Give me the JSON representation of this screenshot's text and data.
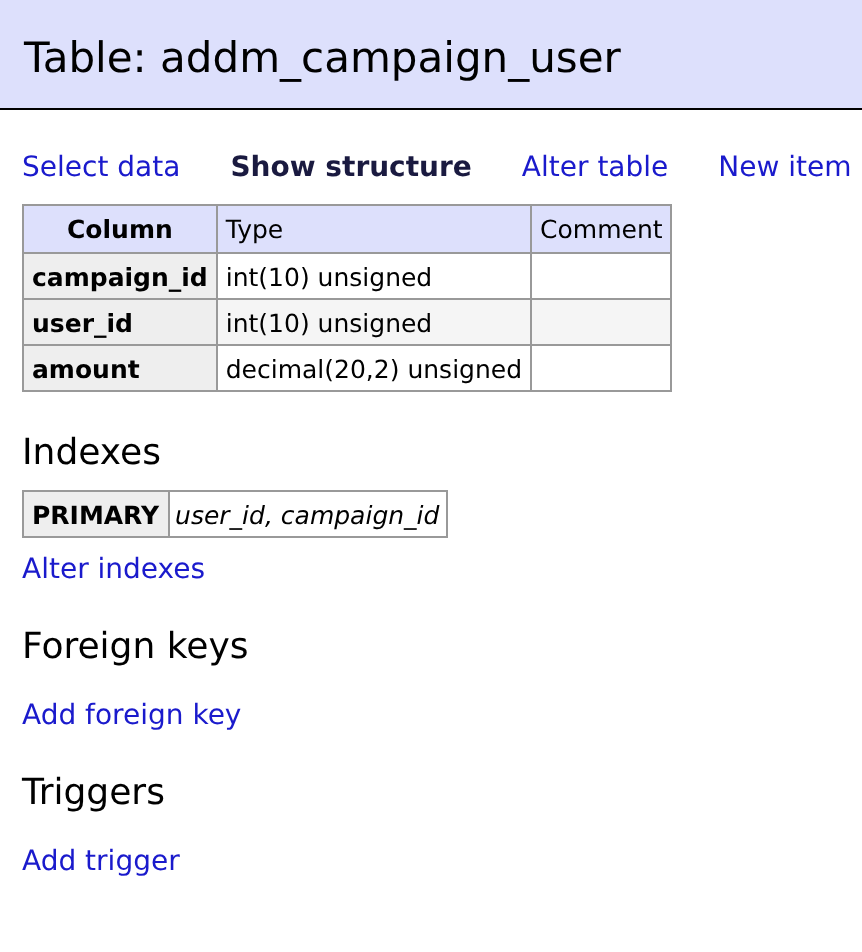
{
  "title": "Table: addm_campaign_user",
  "menu": [
    {
      "label": "Select data",
      "selected": false
    },
    {
      "label": "Show structure",
      "selected": true
    },
    {
      "label": "Alter table",
      "selected": false
    },
    {
      "label": "New item",
      "selected": false
    }
  ],
  "table": {
    "columns": [
      "Column",
      "Type",
      "Comment"
    ],
    "rows": [
      {
        "column": "campaign_id",
        "type": "int(10) unsigned"
      },
      {
        "column": "user_id",
        "type": "int(10) unsigned"
      },
      {
        "column": "amount",
        "type": "decimal(20,2) unsigned"
      }
    ]
  },
  "sections": [
    {
      "heading": "Indexes",
      "indexes": [
        {
          "type": "PRIMARY",
          "columns": "user_id, campaign_id"
        }
      ],
      "link": "Alter indexes"
    },
    {
      "heading": "Foreign keys",
      "link": "Add foreign key"
    },
    {
      "heading": "Triggers",
      "link": "Add trigger"
    }
  ]
}
